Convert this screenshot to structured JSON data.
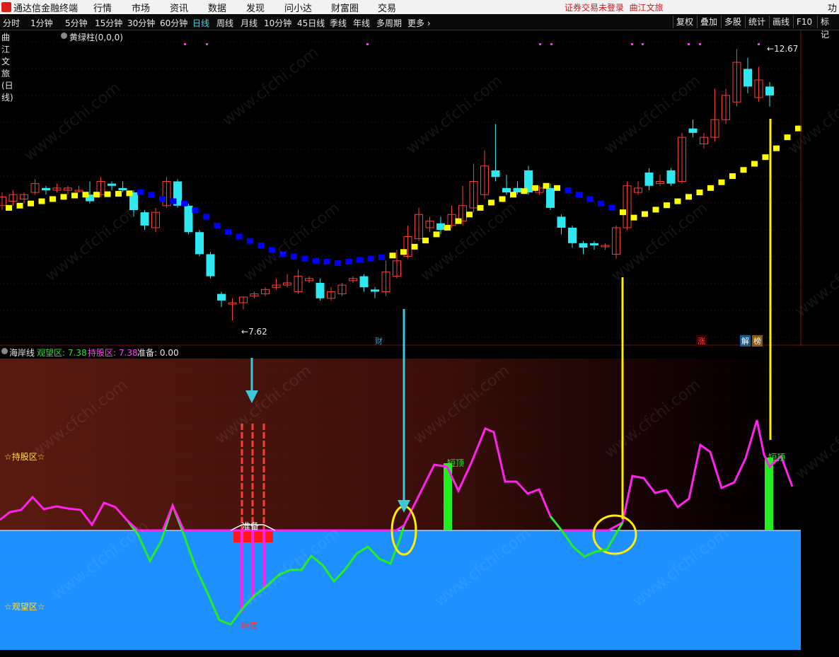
{
  "app": {
    "title": "通达信金融终端",
    "menu": [
      "行情",
      "市场",
      "资讯",
      "数据",
      "发现",
      "问小达",
      "财富圈",
      "交易"
    ],
    "status": "证券交易未登录",
    "stock": "曲江文旅",
    "right_cut": "功"
  },
  "periods": [
    "分时",
    "1分钟",
    "5分钟",
    "15分钟",
    "30分钟",
    "60分钟",
    "日线",
    "周线",
    "月线",
    "10分钟",
    "45日线",
    "季线",
    "年线",
    "多周期",
    "更多 ›"
  ],
  "active_period": "日线",
  "tools": [
    "复权",
    "叠加",
    "多股",
    "统计",
    "画线",
    "F10",
    "标记"
  ],
  "chart_title": {
    "stock": "曲江文旅(日线)",
    "indicator": "黄绿柱(0,0,0)"
  },
  "price_labels": {
    "high": "12.67",
    "low": "7.62"
  },
  "event_tags": {
    "cai": "财",
    "zhang": "涨",
    "jie": "解",
    "bang": "榜"
  },
  "lower_title": {
    "name": "海岸线",
    "watch_label": "观望区:",
    "watch_value": "7.38",
    "hold_label": "持股区:",
    "hold_value": "7.38",
    "ready_label": "准备:",
    "ready_value": "0.00"
  },
  "zones": {
    "hold": "☆持股区☆",
    "watch": "☆观望区☆"
  },
  "annotations": {
    "ready": "准备",
    "bottom": "短底",
    "top1": "短顶",
    "top2": "短顶"
  },
  "watermark": "www.cfchi.com",
  "colors": {
    "up": "#ff3a3a",
    "down": "#2de8f0",
    "bull": "#ffff00",
    "bear": "#0000ff",
    "line_hold": "#ff22ee",
    "line_watch": "#22ee22",
    "watch_area": "#1e90ff",
    "arrow": "#3cc8d8",
    "highlight": "#ffee00"
  },
  "candles": [
    {
      "o": 9.05,
      "c": 9.25,
      "h": 9.35,
      "l": 8.95,
      "bull": true
    },
    {
      "o": 9.15,
      "c": 9.3,
      "h": 9.4,
      "l": 9.05,
      "bull": true
    },
    {
      "o": 9.2,
      "c": 9.3,
      "h": 9.35,
      "l": 9.1,
      "bull": true
    },
    {
      "o": 9.35,
      "c": 9.55,
      "h": 9.65,
      "l": 9.3,
      "bull": true
    },
    {
      "o": 9.45,
      "c": 9.4,
      "h": 9.5,
      "l": 9.3,
      "bull": true
    },
    {
      "o": 9.4,
      "c": 9.45,
      "h": 9.55,
      "l": 9.35,
      "bull": true
    },
    {
      "o": 9.4,
      "c": 9.45,
      "h": 9.5,
      "l": 9.3,
      "bull": true
    },
    {
      "o": 9.4,
      "c": 9.4,
      "h": 9.5,
      "l": 9.35,
      "bull": true
    },
    {
      "o": 9.3,
      "c": 9.15,
      "h": 9.6,
      "l": 9.1,
      "bull": true
    },
    {
      "o": 9.3,
      "c": 9.6,
      "h": 9.7,
      "l": 9.25,
      "bull": true
    },
    {
      "o": 9.55,
      "c": 9.5,
      "h": 9.6,
      "l": 9.4,
      "bull": true
    },
    {
      "o": 9.45,
      "c": 9.4,
      "h": 9.6,
      "l": 9.35,
      "bull": true
    },
    {
      "o": 9.35,
      "c": 8.95,
      "h": 9.4,
      "l": 8.8,
      "bull": false
    },
    {
      "o": 8.9,
      "c": 8.6,
      "h": 8.95,
      "l": 8.5,
      "bull": false
    },
    {
      "o": 8.55,
      "c": 8.9,
      "h": 9.0,
      "l": 8.45,
      "bull": false
    },
    {
      "o": 9.05,
      "c": 9.6,
      "h": 9.7,
      "l": 9.0,
      "bull": false
    },
    {
      "o": 9.6,
      "c": 9.05,
      "h": 9.65,
      "l": 9.0,
      "bull": false
    },
    {
      "o": 9.05,
      "c": 8.45,
      "h": 9.1,
      "l": 8.4,
      "bull": false
    },
    {
      "o": 8.45,
      "c": 7.95,
      "h": 8.5,
      "l": 7.9,
      "bull": false
    },
    {
      "o": 7.95,
      "c": 7.45,
      "h": 8.0,
      "l": 7.4,
      "bull": false
    },
    {
      "o": 7.05,
      "c": 6.9,
      "h": 7.1,
      "l": 6.75,
      "bull": false
    },
    {
      "o": 6.85,
      "c": 6.85,
      "h": 6.95,
      "l": 6.45,
      "bull": false
    },
    {
      "o": 6.85,
      "c": 6.98,
      "h": 7.0,
      "l": 6.7,
      "bull": false
    },
    {
      "o": 7.0,
      "c": 7.05,
      "h": 7.1,
      "l": 6.95,
      "bull": false
    },
    {
      "o": 7.05,
      "c": 7.15,
      "h": 7.2,
      "l": 7.0,
      "bull": false
    },
    {
      "o": 7.2,
      "c": 7.25,
      "h": 7.4,
      "l": 7.15,
      "bull": false
    },
    {
      "o": 7.25,
      "c": 7.3,
      "h": 7.5,
      "l": 7.2,
      "bull": false
    },
    {
      "o": 7.1,
      "c": 7.45,
      "h": 7.6,
      "l": 7.05,
      "bull": false
    },
    {
      "o": 7.35,
      "c": 7.4,
      "h": 7.45,
      "l": 7.3,
      "bull": false
    },
    {
      "o": 7.3,
      "c": 6.95,
      "h": 7.4,
      "l": 6.9,
      "bull": false
    },
    {
      "o": 6.95,
      "c": 7.1,
      "h": 7.2,
      "l": 6.9,
      "bull": false
    },
    {
      "o": 7.05,
      "c": 7.25,
      "h": 7.3,
      "l": 7.0,
      "bull": false
    },
    {
      "o": 7.35,
      "c": 7.4,
      "h": 7.45,
      "l": 7.3,
      "bull": false
    },
    {
      "o": 7.45,
      "c": 7.2,
      "h": 7.5,
      "l": 7.1,
      "bull": false
    },
    {
      "o": 7.15,
      "c": 7.1,
      "h": 7.2,
      "l": 6.95,
      "bull": false
    },
    {
      "o": 7.1,
      "c": 7.55,
      "h": 7.8,
      "l": 7.0,
      "bull": true
    },
    {
      "o": 7.45,
      "c": 7.8,
      "h": 8.05,
      "l": 7.4,
      "bull": true
    },
    {
      "o": 7.9,
      "c": 8.35,
      "h": 8.6,
      "l": 7.85,
      "bull": true
    },
    {
      "o": 8.3,
      "c": 8.85,
      "h": 9.0,
      "l": 8.25,
      "bull": true
    },
    {
      "o": 8.55,
      "c": 8.7,
      "h": 8.8,
      "l": 8.45,
      "bull": true
    },
    {
      "o": 8.65,
      "c": 8.5,
      "h": 8.8,
      "l": 8.4,
      "bull": true
    },
    {
      "o": 8.6,
      "c": 8.85,
      "h": 9.05,
      "l": 8.55,
      "bull": true
    },
    {
      "o": 8.7,
      "c": 9.05,
      "h": 9.5,
      "l": 8.6,
      "bull": true
    },
    {
      "o": 9.0,
      "c": 9.6,
      "h": 10.0,
      "l": 8.9,
      "bull": true
    },
    {
      "o": 9.3,
      "c": 9.95,
      "h": 10.3,
      "l": 9.2,
      "bull": true
    },
    {
      "o": 9.85,
      "c": 9.7,
      "h": 10.9,
      "l": 9.6,
      "bull": true
    },
    {
      "o": 9.45,
      "c": 9.35,
      "h": 9.75,
      "l": 9.3,
      "bull": true
    },
    {
      "o": 9.45,
      "c": 9.35,
      "h": 9.6,
      "l": 9.3,
      "bull": true
    },
    {
      "o": 9.85,
      "c": 9.35,
      "h": 9.95,
      "l": 9.3,
      "bull": true
    },
    {
      "o": 9.35,
      "c": 9.45,
      "h": 9.5,
      "l": 9.3,
      "bull": true
    },
    {
      "o": 9.45,
      "c": 9.0,
      "h": 9.55,
      "l": 8.95,
      "bull": true
    },
    {
      "o": 8.8,
      "c": 8.55,
      "h": 8.85,
      "l": 8.4,
      "bull": false
    },
    {
      "o": 8.55,
      "c": 8.2,
      "h": 8.6,
      "l": 8.1,
      "bull": false
    },
    {
      "o": 8.2,
      "c": 8.1,
      "h": 8.25,
      "l": 7.95,
      "bull": false
    },
    {
      "o": 8.2,
      "c": 8.15,
      "h": 8.25,
      "l": 8.05,
      "bull": false
    },
    {
      "o": 8.15,
      "c": 8.15,
      "h": 8.2,
      "l": 8.05,
      "bull": false
    },
    {
      "o": 7.95,
      "c": 8.55,
      "h": 8.6,
      "l": 7.85,
      "bull": true
    },
    {
      "o": 8.55,
      "c": 9.5,
      "h": 9.6,
      "l": 8.5,
      "bull": true
    },
    {
      "o": 9.35,
      "c": 9.45,
      "h": 9.6,
      "l": 9.3,
      "bull": true
    },
    {
      "o": 9.8,
      "c": 9.5,
      "h": 9.9,
      "l": 9.4,
      "bull": true
    },
    {
      "o": 9.55,
      "c": 9.6,
      "h": 9.75,
      "l": 9.5,
      "bull": true
    },
    {
      "o": 9.85,
      "c": 9.55,
      "h": 9.9,
      "l": 9.5,
      "bull": true
    },
    {
      "o": 9.6,
      "c": 10.6,
      "h": 10.7,
      "l": 9.55,
      "bull": true
    },
    {
      "o": 10.8,
      "c": 10.7,
      "h": 11.0,
      "l": 10.6,
      "bull": true
    },
    {
      "o": 10.45,
      "c": 10.6,
      "h": 10.7,
      "l": 10.35,
      "bull": true
    },
    {
      "o": 10.6,
      "c": 11.0,
      "h": 11.7,
      "l": 10.5,
      "bull": true
    },
    {
      "o": 11.0,
      "c": 11.55,
      "h": 11.7,
      "l": 10.9,
      "bull": true
    },
    {
      "o": 11.4,
      "c": 12.3,
      "h": 12.6,
      "l": 11.3,
      "bull": true
    },
    {
      "o": 12.15,
      "c": 11.75,
      "h": 12.4,
      "l": 11.6,
      "bull": true
    },
    {
      "o": 11.5,
      "c": 11.9,
      "h": 12.2,
      "l": 11.4,
      "bull": true
    },
    {
      "o": 11.75,
      "c": 11.55,
      "h": 11.85,
      "l": 11.3,
      "bull": true
    }
  ],
  "guide": [
    9.0,
    9.05,
    9.1,
    9.15,
    9.2,
    9.25,
    9.28,
    9.3,
    9.3,
    9.31,
    9.32,
    9.33,
    9.36,
    9.3,
    9.2,
    9.15,
    9.1,
    8.95,
    8.8,
    8.6,
    8.45,
    8.35,
    8.25,
    8.15,
    8.05,
    7.95,
    7.9,
    7.85,
    7.8,
    7.78,
    7.75,
    7.78,
    7.82,
    7.85,
    7.88,
    7.92,
    8.0,
    8.12,
    8.26,
    8.4,
    8.55,
    8.7,
    8.85,
    9.0,
    9.12,
    9.2,
    9.3,
    9.38,
    9.45,
    9.5,
    9.45,
    9.4,
    9.3,
    9.2,
    9.1,
    9.0,
    8.9,
    8.78,
    8.86,
    8.96,
    9.06,
    9.15,
    9.25,
    9.35,
    9.45,
    9.58,
    9.72,
    9.86,
    10.0,
    10.15,
    10.35,
    10.6,
    10.8
  ]
}
